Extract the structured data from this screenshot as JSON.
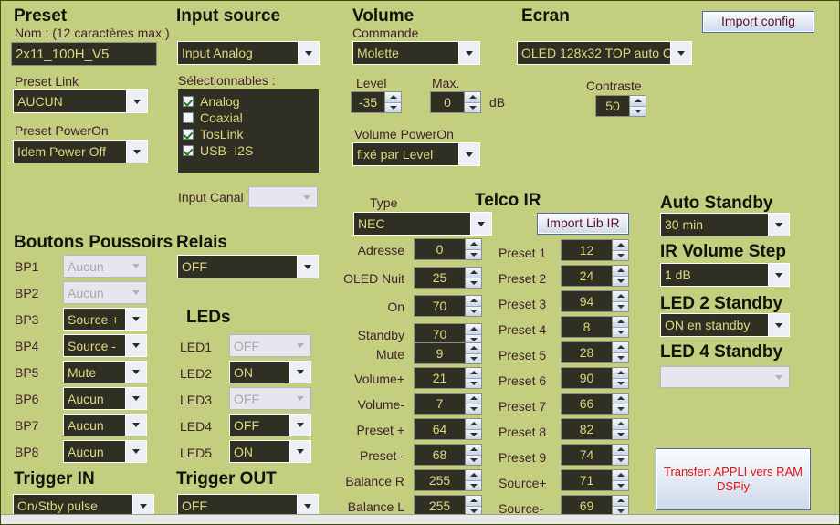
{
  "app": {
    "background_color": "#c3cf7e",
    "field_bg": "#2f2f24",
    "field_text": "#ded97f"
  },
  "header": {
    "import_config_button": "Import config"
  },
  "preset": {
    "title": "Preset",
    "name_label": "Nom : (12 caractères max.)",
    "name_value": "2x11_100H_V5",
    "link_label": "Preset Link",
    "link_value": "AUCUN",
    "poweron_label": "Preset PowerOn",
    "poweron_value": "Idem Power Off"
  },
  "input_source": {
    "title": "Input source",
    "source_value": "Input Analog",
    "selectables_label": "Sélectionnables :",
    "options": [
      {
        "label": "Analog",
        "checked": true
      },
      {
        "label": "Coaxial",
        "checked": false
      },
      {
        "label": "TosLink",
        "checked": true
      },
      {
        "label": "USB- I2S",
        "checked": true
      }
    ],
    "input_canal_label": "Input Canal",
    "input_canal_value": ""
  },
  "volume": {
    "title": "Volume",
    "commande_label": "Commande",
    "commande_value": "Molette",
    "level_label": "Level",
    "level_value": "-35",
    "max_label": "Max.",
    "max_value": "0",
    "db_label": "dB",
    "poweron_label": "Volume PowerOn",
    "poweron_value": "fixé par Level"
  },
  "ecran": {
    "title": "Ecran",
    "display_value": "OLED 128x32 TOP auto C",
    "contraste_label": "Contraste",
    "contraste_value": "50"
  },
  "boutons_poussoirs": {
    "title": "Boutons Poussoirs",
    "rows": [
      {
        "label": "BP1",
        "value": "Aucun",
        "disabled": true
      },
      {
        "label": "BP2",
        "value": "Aucun",
        "disabled": true
      },
      {
        "label": "BP3",
        "value": "Source +",
        "disabled": false
      },
      {
        "label": "BP4",
        "value": "Source -",
        "disabled": false
      },
      {
        "label": "BP5",
        "value": "Mute",
        "disabled": false
      },
      {
        "label": "BP6",
        "value": "Aucun",
        "disabled": false
      },
      {
        "label": "BP7",
        "value": "Aucun",
        "disabled": false
      },
      {
        "label": "BP8",
        "value": "Aucun",
        "disabled": false
      }
    ]
  },
  "relais": {
    "title": "Relais",
    "value": "OFF"
  },
  "leds": {
    "title": "LEDs",
    "rows": [
      {
        "label": "LED1",
        "value": "OFF",
        "disabled": true
      },
      {
        "label": "LED2",
        "value": "ON",
        "disabled": false
      },
      {
        "label": "LED3",
        "value": "OFF",
        "disabled": true
      },
      {
        "label": "LED4",
        "value": "OFF",
        "disabled": false
      },
      {
        "label": "LED5",
        "value": "ON",
        "disabled": false
      }
    ]
  },
  "trigger_in": {
    "title": "Trigger IN",
    "value": "On/Stby pulse"
  },
  "trigger_out": {
    "title": "Trigger OUT",
    "value": "OFF"
  },
  "telco_ir": {
    "title": "Telco IR",
    "type_label": "Type",
    "type_value": "NEC",
    "import_lib_button": "Import Lib IR",
    "left_rows": [
      {
        "label": "Adresse",
        "value": "0"
      },
      {
        "label": "OLED Nuit",
        "value": "25"
      },
      {
        "label": "On",
        "value": "70"
      },
      {
        "label": "Standby",
        "value": "70"
      },
      {
        "label": "Mute",
        "value": "9"
      },
      {
        "label": "Volume+",
        "value": "21"
      },
      {
        "label": "Volume-",
        "value": "7"
      },
      {
        "label": "Preset +",
        "value": "64"
      },
      {
        "label": "Preset -",
        "value": "68"
      },
      {
        "label": "Balance R",
        "value": "255"
      },
      {
        "label": "Balance L",
        "value": "255"
      }
    ],
    "right_rows": [
      {
        "label": "Preset 1",
        "value": "12"
      },
      {
        "label": "Preset 2",
        "value": "24"
      },
      {
        "label": "Preset 3",
        "value": "94"
      },
      {
        "label": "Preset 4",
        "value": "8"
      },
      {
        "label": "Preset 5",
        "value": "28"
      },
      {
        "label": "Preset 6",
        "value": "90"
      },
      {
        "label": "Preset 7",
        "value": "66"
      },
      {
        "label": "Preset 8",
        "value": "82"
      },
      {
        "label": "Preset 9",
        "value": "74"
      },
      {
        "label": "Source+",
        "value": "71"
      },
      {
        "label": "Source-",
        "value": "69"
      }
    ]
  },
  "right_panel": {
    "auto_standby_label": "Auto Standby",
    "auto_standby_value": "30 min",
    "ir_volume_step_label": "IR Volume Step",
    "ir_volume_step_value": "1   dB",
    "led2_standby_label": "LED 2 Standby",
    "led2_standby_value": "ON en standby",
    "led4_standby_label": "LED 4 Standby",
    "led4_standby_value": "",
    "transfer_button_line1": "Transfert APPLI vers RAM",
    "transfer_button_line2": "DSPiy"
  }
}
